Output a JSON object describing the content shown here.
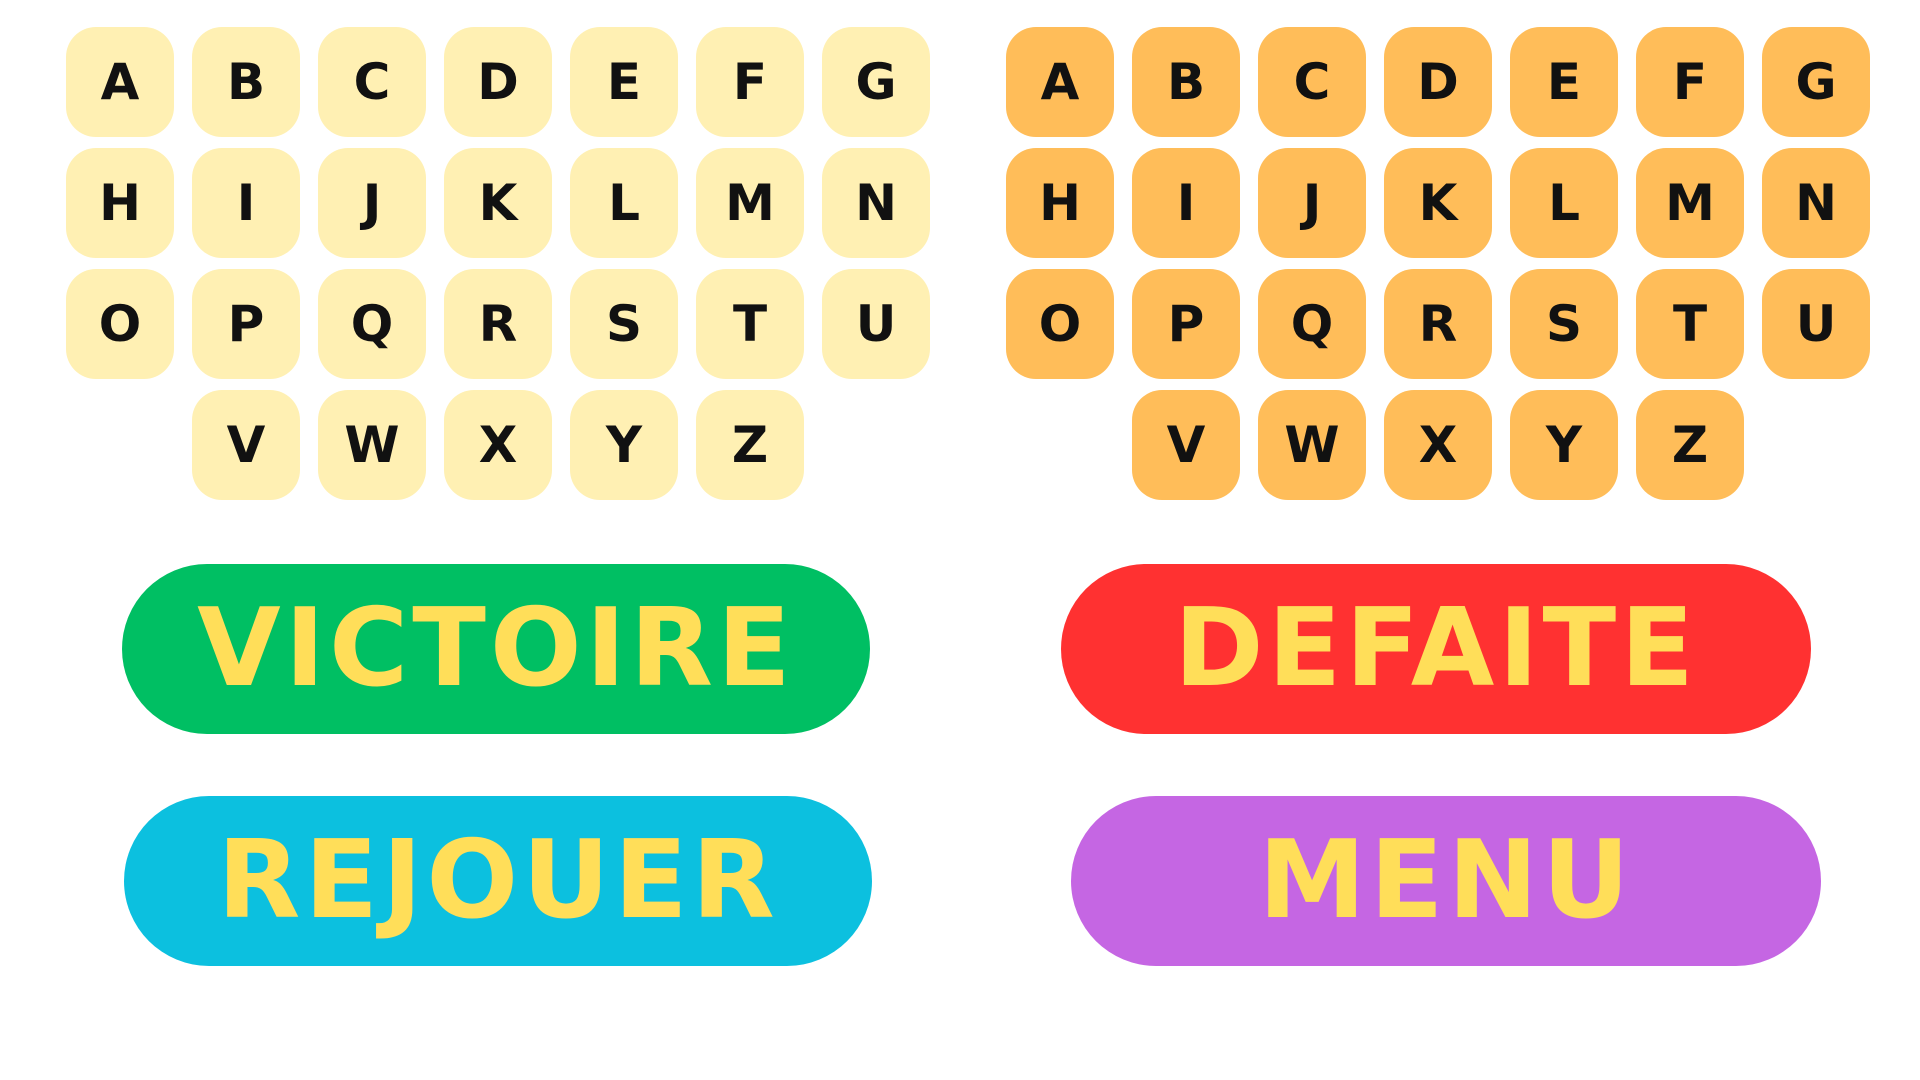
{
  "keyboard_left": {
    "key_color": "#FFF0B3",
    "rows": [
      [
        "A",
        "B",
        "C",
        "D",
        "E",
        "F",
        "G"
      ],
      [
        "H",
        "I",
        "J",
        "K",
        "L",
        "M",
        "N"
      ],
      [
        "O",
        "P",
        "Q",
        "R",
        "S",
        "T",
        "U"
      ],
      [
        "V",
        "W",
        "X",
        "Y",
        "Z"
      ]
    ]
  },
  "keyboard_right": {
    "key_color": "#FFBD59",
    "rows": [
      [
        "A",
        "B",
        "C",
        "D",
        "E",
        "F",
        "G"
      ],
      [
        "H",
        "I",
        "J",
        "K",
        "L",
        "M",
        "N"
      ],
      [
        "O",
        "P",
        "Q",
        "R",
        "S",
        "T",
        "U"
      ],
      [
        "V",
        "W",
        "X",
        "Y",
        "Z"
      ]
    ]
  },
  "buttons": {
    "victoire": {
      "label": "VICTOIRE",
      "color": "#00BF63"
    },
    "defaite": {
      "label": "DEFAITE",
      "color": "#FF3131"
    },
    "rejouer": {
      "label": "REJOUER",
      "color": "#0CC0DF"
    },
    "menu": {
      "label": "MENU",
      "color": "#C566E3"
    },
    "text_color": "#FFDE59"
  }
}
